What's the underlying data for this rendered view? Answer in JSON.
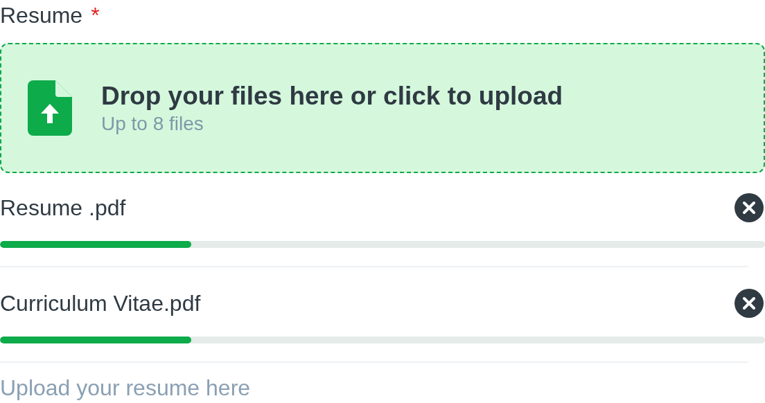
{
  "field": {
    "label": "Resume",
    "required_mark": "*"
  },
  "dropzone": {
    "title": "Drop your files here or click to upload",
    "subtitle": "Up to 8 files"
  },
  "files": [
    {
      "name": "Resume .pdf",
      "level": 0.25
    },
    {
      "name": "Curriculum Vitae.pdf",
      "level": 0.25
    }
  ],
  "helper_text": "Upload your resume here"
}
